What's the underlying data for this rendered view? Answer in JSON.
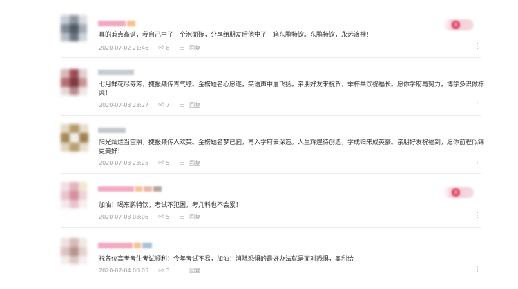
{
  "comments": [
    {
      "text": "真的兼点高谱，我自己中了一个泡面碗，分享给朋友后他中了一箱东鹏特饮。东鹏特饮，永远滴神！",
      "time": "2020-07-02 21:46",
      "likes": "8",
      "reply_label": "回复",
      "has_badge": true,
      "badge_label": "关"
    },
    {
      "text": "七月鲜花尽芬芳，捷报频传青气缭。金榜题名心愿遂，笑语声中眉飞扬。亲朋好友来祝贺，举杯共饮祝福长。愿你学府再努力，博学多识做栋梁！",
      "time": "2020-07-03 23:27",
      "likes": "7",
      "reply_label": "回复",
      "has_badge": false
    },
    {
      "text": "阳光灿烂当空照，捷报频传人欢笑。金榜题名梦已圆，再入学府去深造。人生辉煌待创造，学成归来成英豪。亲朋好友祝福到，愿你前程似锦更美好！",
      "time": "2020-07-03 23:25",
      "likes": "5",
      "reply_label": "回复",
      "has_badge": false
    },
    {
      "text": "加油！喝东鹏特饮，考试不犯困，考几科也不会累！",
      "time": "2020-07-03 08:06",
      "likes": "5",
      "reply_label": "回复",
      "has_badge": true,
      "badge_label": "关"
    },
    {
      "text": "祝各位高考考生考试顺利！今年考试不易，加油！消除恐惧的最好办法就是面对恐惧，奥利给",
      "time": "2020-07-04 00:05",
      "likes": "3",
      "reply_label": "回复",
      "has_badge": false
    }
  ],
  "icons": {
    "like": "thumbs-up-icon",
    "comment": "comment-bubble-icon",
    "more": "more-vertical-icon"
  },
  "colors": {
    "username_pink": "#f3a9bf",
    "badge_red": "#e2395c",
    "meta_gray": "#9aa0a6",
    "separator": "#ececec"
  }
}
